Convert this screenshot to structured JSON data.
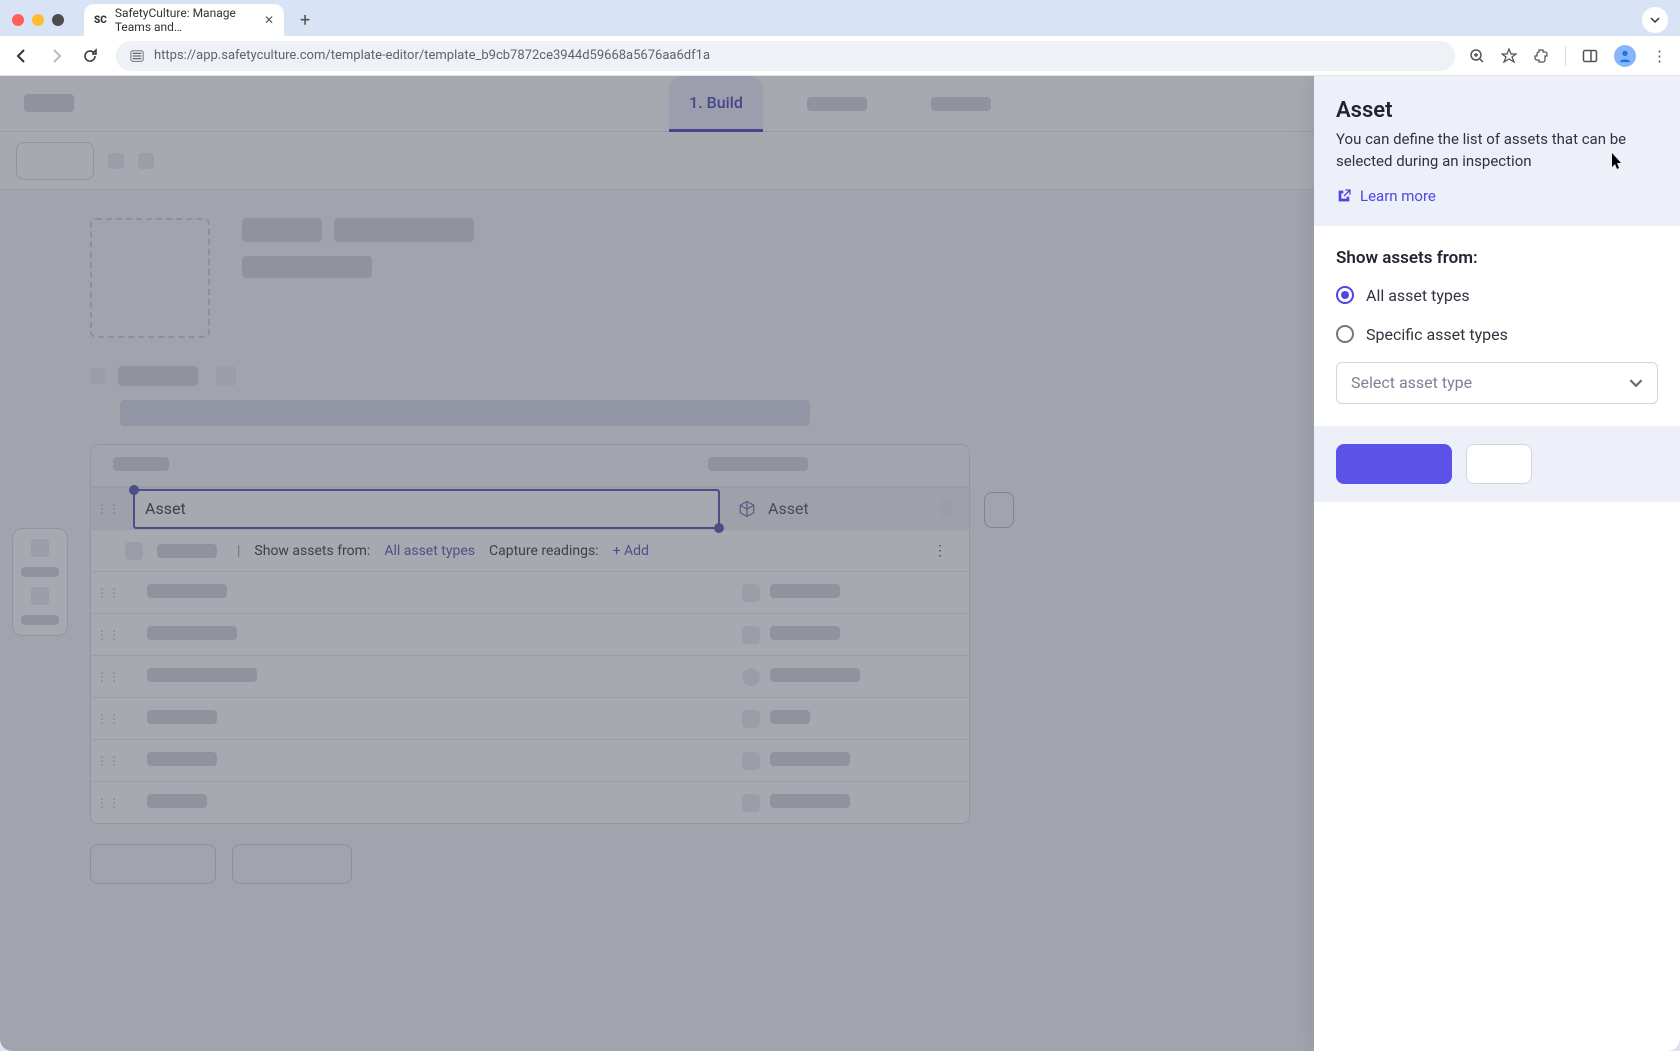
{
  "browser": {
    "tab_title": "SafetyCulture: Manage Teams and…",
    "url": "https://app.safetyculture.com/template-editor/template_b9cb7872ce3944d59668a5676aa6df1a"
  },
  "nav": {
    "active_tab": "1. Build"
  },
  "asset_question": {
    "label": "Asset",
    "type_label": "Asset"
  },
  "asset_subrow": {
    "show_from_label": "Show assets from:",
    "show_from_value": "All asset types",
    "capture_label": "Capture readings:",
    "add_label": "+ Add"
  },
  "panel": {
    "title": "Asset",
    "description": "You can define the list of assets that can be selected during an inspection",
    "learn_more": "Learn more",
    "section_label": "Show assets from:",
    "option_all": "All asset types",
    "option_specific": "Specific asset types",
    "select_placeholder": "Select asset type"
  }
}
